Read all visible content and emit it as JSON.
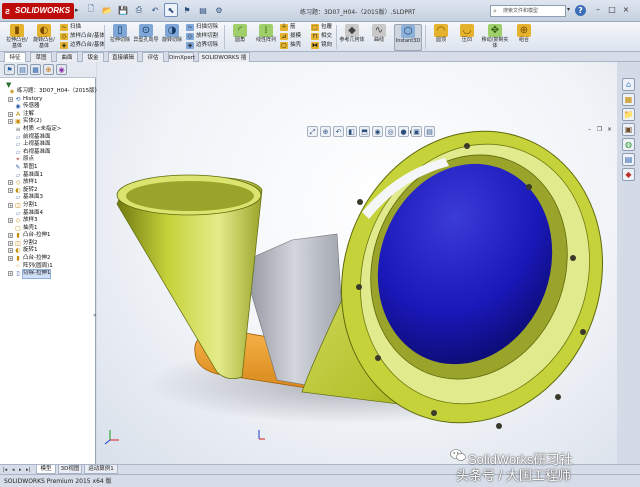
{
  "app": {
    "logo_text": "SOLIDWORKS",
    "doc_title": "练习题：3D07_H04-（2015版）.SLDPRT",
    "search_placeholder": "搜索文件和模型",
    "help_icon": "?",
    "window_controls": [
      "–",
      "□",
      "×"
    ]
  },
  "ribbon": {
    "big_buttons": [
      {
        "label": "拉伸凸台/基体",
        "icon": "extrude-boss-icon"
      },
      {
        "label": "旋转凸台/基体",
        "icon": "revolve-boss-icon"
      },
      {
        "label": "拉伸切除",
        "icon": "extrude-cut-icon"
      },
      {
        "label": "异型孔向导",
        "icon": "hole-wizard-icon"
      },
      {
        "label": "旋转切除",
        "icon": "revolve-cut-icon"
      },
      {
        "label": "圆角",
        "icon": "fillet-icon"
      },
      {
        "label": "线性阵列",
        "icon": "linear-pattern-icon"
      },
      {
        "label": "参考几何体",
        "icon": "reference-geometry-icon"
      },
      {
        "label": "曲线",
        "icon": "curves-icon"
      },
      {
        "label": "Instant3D",
        "icon": "instant3d-icon"
      },
      {
        "label": "圆顶",
        "icon": "dome-icon"
      },
      {
        "label": "压凹",
        "icon": "indent-icon"
      },
      {
        "label": "移动/复制实体",
        "icon": "move-copy-icon"
      },
      {
        "label": "组合",
        "icon": "combine-icon"
      }
    ],
    "small_buttons": [
      {
        "label": "扫描",
        "icon": "sweep-icon"
      },
      {
        "label": "放样凸台/基体",
        "icon": "loft-boss-icon"
      },
      {
        "label": "边界凸台/基体",
        "icon": "boundary-boss-icon"
      },
      {
        "label": "扫描切除",
        "icon": "swept-cut-icon"
      },
      {
        "label": "放样切割",
        "icon": "lofted-cut-icon"
      },
      {
        "label": "边界切除",
        "icon": "boundary-cut-icon"
      },
      {
        "label": "筋",
        "icon": "rib-icon"
      },
      {
        "label": "拔模",
        "icon": "draft-icon"
      },
      {
        "label": "抽壳",
        "icon": "shell-icon"
      },
      {
        "label": "包覆",
        "icon": "wrap-icon"
      },
      {
        "label": "相交",
        "icon": "intersect-icon"
      },
      {
        "label": "镜向",
        "icon": "mirror-icon"
      }
    ]
  },
  "tabs": [
    {
      "label": "特征",
      "selected": true
    },
    {
      "label": "草图",
      "selected": false
    },
    {
      "label": "曲面",
      "selected": false
    },
    {
      "label": "钣金",
      "selected": false
    },
    {
      "label": "直接编辑",
      "selected": false
    },
    {
      "label": "评估",
      "selected": false
    },
    {
      "label": "DimXpert",
      "selected": false
    },
    {
      "label": "SOLIDWORKS 插件",
      "selected": false
    }
  ],
  "feature_tree": [
    {
      "label": "练习题：3D07_H04-（2015版）",
      "icon": "part-icon",
      "indent": 0,
      "toggle": ""
    },
    {
      "label": "History",
      "icon": "history-icon",
      "indent": 1,
      "toggle": "+"
    },
    {
      "label": "传感器",
      "icon": "sensor-icon",
      "indent": 1,
      "toggle": ""
    },
    {
      "label": "注解",
      "icon": "annotation-icon",
      "indent": 1,
      "toggle": "+"
    },
    {
      "label": "实体(2)",
      "icon": "solid-bodies-icon",
      "indent": 1,
      "toggle": "+"
    },
    {
      "label": "材质 <未指定>",
      "icon": "material-icon",
      "indent": 1,
      "toggle": ""
    },
    {
      "label": "前视基准面",
      "icon": "plane-icon",
      "indent": 1,
      "toggle": ""
    },
    {
      "label": "上视基准面",
      "icon": "plane-icon",
      "indent": 1,
      "toggle": ""
    },
    {
      "label": "右视基准面",
      "icon": "plane-icon",
      "indent": 1,
      "toggle": ""
    },
    {
      "label": "原点",
      "icon": "origin-icon",
      "indent": 1,
      "toggle": ""
    },
    {
      "label": "草图1",
      "icon": "sketch-icon",
      "indent": 1,
      "toggle": ""
    },
    {
      "label": "基准面1",
      "icon": "plane-icon",
      "indent": 1,
      "toggle": ""
    },
    {
      "label": "放样1",
      "icon": "loft-icon",
      "indent": 1,
      "toggle": "+"
    },
    {
      "label": "旋转2",
      "icon": "revolve-icon",
      "indent": 1,
      "toggle": "+"
    },
    {
      "label": "基准面3",
      "icon": "plane-icon",
      "indent": 1,
      "toggle": ""
    },
    {
      "label": "分割1",
      "icon": "split-icon",
      "indent": 1,
      "toggle": "+"
    },
    {
      "label": "基准面4",
      "icon": "plane-icon",
      "indent": 1,
      "toggle": ""
    },
    {
      "label": "放样3",
      "icon": "loft-icon",
      "indent": 1,
      "toggle": "+"
    },
    {
      "label": "抽壳1",
      "icon": "shell-icon",
      "indent": 1,
      "toggle": ""
    },
    {
      "label": "凸台-拉伸1",
      "icon": "extrude-icon",
      "indent": 1,
      "toggle": "+"
    },
    {
      "label": "分割2",
      "icon": "split-icon",
      "indent": 1,
      "toggle": "+"
    },
    {
      "label": "旋转1",
      "icon": "revolve-icon",
      "indent": 1,
      "toggle": "+"
    },
    {
      "label": "凸台-拉伸2",
      "icon": "extrude-icon",
      "indent": 1,
      "toggle": "+"
    },
    {
      "label": "阵列(圆周)1",
      "icon": "pattern-icon",
      "indent": 1,
      "toggle": ""
    },
    {
      "label": "切除-拉伸1",
      "icon": "cut-extrude-icon",
      "indent": 1,
      "toggle": "+",
      "highlight": true
    }
  ],
  "bottom_tabs": [
    {
      "label": "模型",
      "selected": true
    },
    {
      "label": "3D视图",
      "selected": false
    },
    {
      "label": "运动算例1",
      "selected": false
    }
  ],
  "status": {
    "text": "SOLIDWORKS Premium 2015 x64 版"
  },
  "watermark": {
    "line1": "SolidWorks研习社",
    "line2": "头条号 / 大国工程师"
  },
  "colors": {
    "part_green": "#c6d23a",
    "inner_blue": "#1a18b8",
    "base_orange": "#f0a232",
    "logo_red": "#c00b0b"
  }
}
